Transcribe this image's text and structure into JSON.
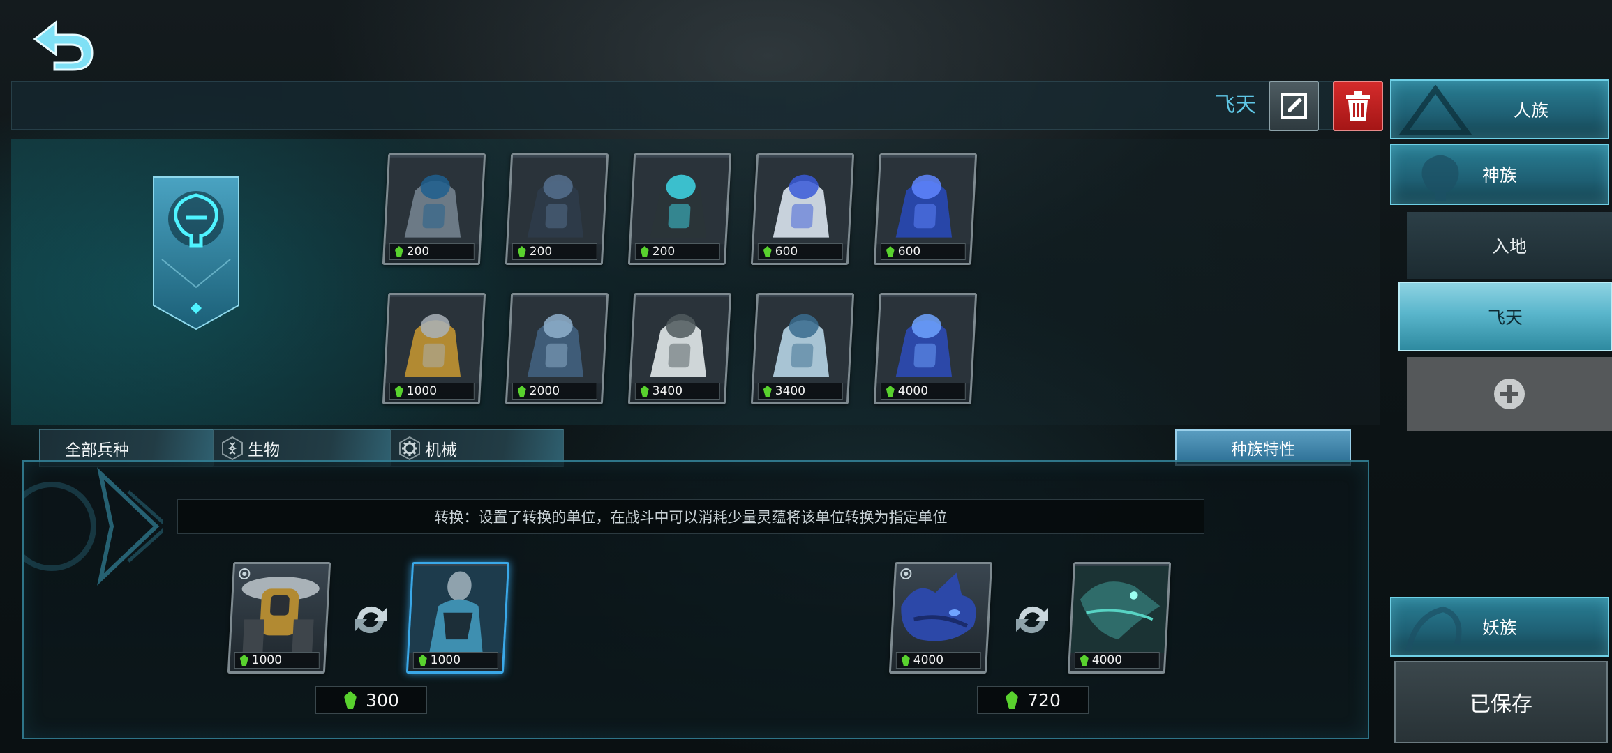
{
  "header": {
    "deck_name": "飞天"
  },
  "units": [
    {
      "cost": "200",
      "art": "armored-infantry"
    },
    {
      "cost": "200",
      "art": "heavy-mech"
    },
    {
      "cost": "200",
      "art": "cyborg-soldier"
    },
    {
      "cost": "600",
      "art": "fighter-jet"
    },
    {
      "cost": "600",
      "art": "blue-drone"
    },
    {
      "cost": "1000",
      "art": "gold-guardian",
      "pinned": true
    },
    {
      "cost": "2000",
      "art": "titan-golem"
    },
    {
      "cost": "3400",
      "art": "gunship-white"
    },
    {
      "cost": "3400",
      "art": "gunship-blue"
    },
    {
      "cost": "4000",
      "art": "leviathan",
      "pinned": true
    }
  ],
  "filters": {
    "all": "全部兵种",
    "bio": "生物",
    "mech": "机械"
  },
  "race_traits_label": "种族特性",
  "conversion": {
    "description": "转换：设置了转换的单位，在战斗中可以消耗少量灵蕴将该单位转换为指定单位",
    "pairs": [
      {
        "from_cost": "1000",
        "to_cost": "1000",
        "price": "300"
      },
      {
        "from_cost": "4000",
        "to_cost": "4000",
        "price": "720"
      }
    ]
  },
  "sidebar": {
    "races": [
      "人族",
      "神族"
    ],
    "decks": [
      "入地",
      "飞天"
    ],
    "race_bottom": "妖族",
    "save_label": "已保存"
  },
  "colors": {
    "accent": "#5fc7e6",
    "delete": "#c42020",
    "gem": "#59d22e"
  }
}
